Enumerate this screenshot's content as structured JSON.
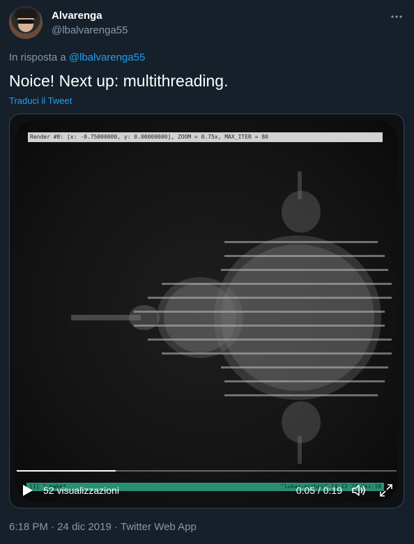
{
  "tweet": {
    "author_name": "Alvarenga",
    "author_handle": "@lbalvarenga55",
    "reply_prefix": "In risposta a",
    "reply_to": "@lbalvarenga55",
    "text": "Noice! Next up: multithreading.",
    "translate_link": "Traduci il Tweet"
  },
  "video": {
    "terminal_title": "Render #8: [x: -0.75000000, y: 0.00000000], ZOOM = 0.75x, MAX_ITER = 80",
    "status_left": "[1] 1:make*",
    "status_right": "\"lukas-archpc\" 14:12 24-dez-19",
    "views": "52 visualizzazioni",
    "time": "0:05 / 0:19",
    "progress": 0.26
  },
  "footer": {
    "time": "6:18 PM",
    "sep1": " · ",
    "date": "24 dic 2019",
    "sep2": " · ",
    "source": "Twitter Web App"
  },
  "icons": {
    "more": "more-icon",
    "play": "play-icon",
    "volume": "volume-icon",
    "expand": "expand-icon"
  },
  "colors": {
    "background": "#15202b",
    "accent": "#1da1f2",
    "muted": "#8899a6",
    "terminal_status": "#2a8f72"
  }
}
